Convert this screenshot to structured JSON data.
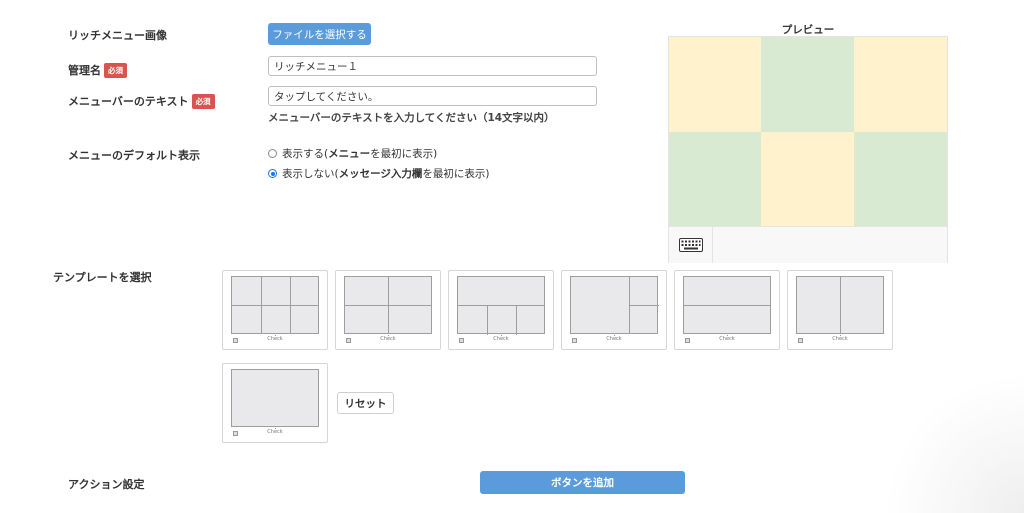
{
  "form": {
    "image_label": "リッチメニュー画像",
    "file_button": "ファイルを選択する",
    "name_label": "管理名",
    "required_badge": "必須",
    "name_value": "リッチメニュー１",
    "menubar_label": "メニューバーのテキスト",
    "menubar_value": "タップしてください。",
    "menubar_help": "メニューバーのテキストを入力してください（14文字以内）",
    "default_label": "メニューのデフォルト表示",
    "radio_show_prefix": "表示する(",
    "radio_show_bold": "メニュー",
    "radio_show_suffix": "を最初に表示)",
    "radio_hide_prefix": "表示しない(",
    "radio_hide_bold": "メッセージ入力欄",
    "radio_hide_suffix": "を最初に表示)",
    "selected_option": "hide"
  },
  "preview": {
    "title": "プレビュー",
    "colors": {
      "yellow": "#fff2cc",
      "green": "#d9ead3"
    },
    "keyboard_icon": "keyboard-icon"
  },
  "templates": {
    "label": "テンプレートを選択",
    "check_text": "Check",
    "reset_button": "リセット",
    "items": [
      "grid-2x3",
      "grid-2x2",
      "top1-bottom3",
      "left1-right2",
      "top1-bottom1",
      "left1-right1",
      "single"
    ]
  },
  "action": {
    "label": "アクション設定",
    "add_button": "ボタンを追加"
  },
  "colors": {
    "primary": "#5b9bdc",
    "required": "#d9534f"
  }
}
